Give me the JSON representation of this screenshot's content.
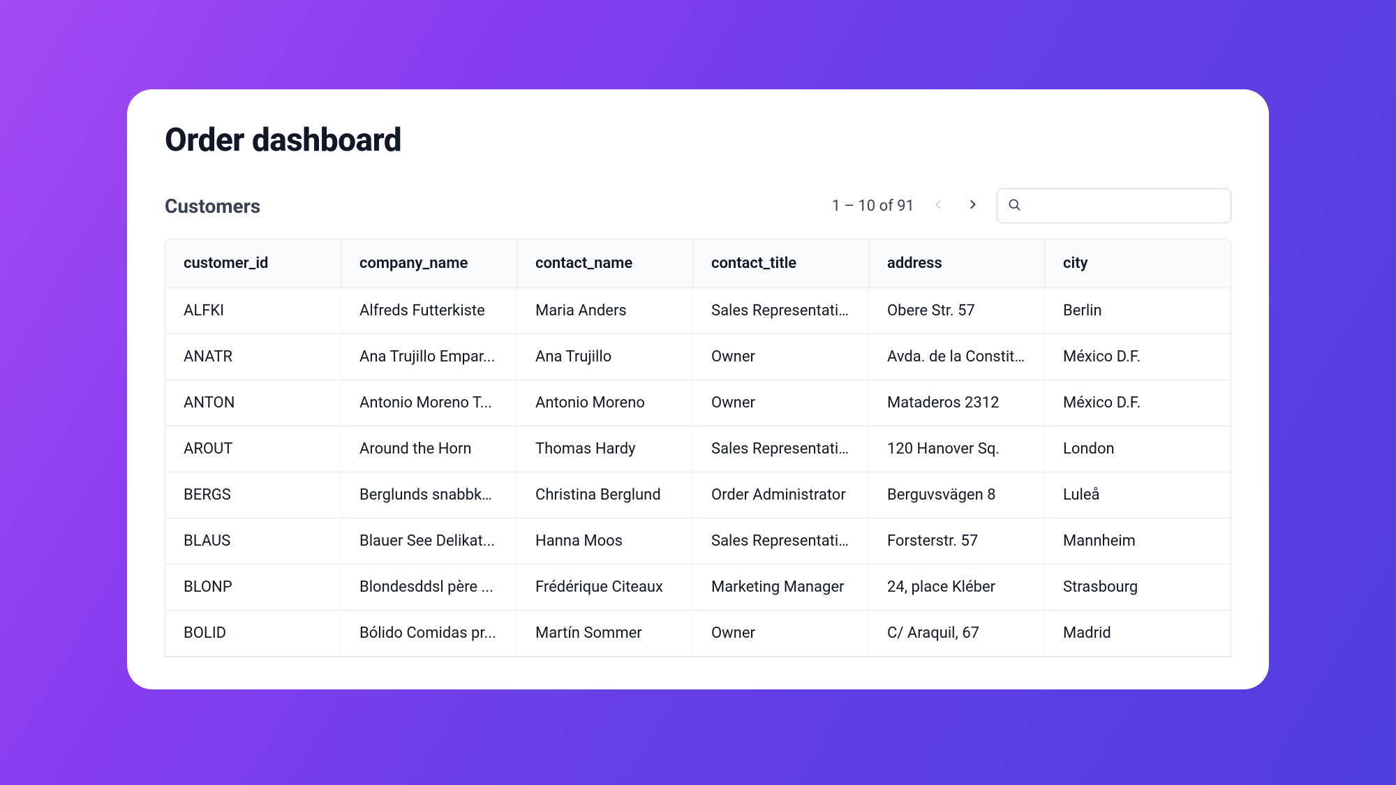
{
  "page": {
    "title": "Order dashboard"
  },
  "section": {
    "title": "Customers"
  },
  "pagination": {
    "range_text": "1 – 10 of 91"
  },
  "search": {
    "value": "",
    "placeholder": ""
  },
  "table": {
    "columns": [
      "customer_id",
      "company_name",
      "contact_name",
      "contact_title",
      "address",
      "city"
    ],
    "rows": [
      {
        "customer_id": "ALFKI",
        "company_name": "Alfreds Futterkiste",
        "contact_name": "Maria Anders",
        "contact_title": "Sales Representati...",
        "address": "Obere Str. 57",
        "city": "Berlin"
      },
      {
        "customer_id": "ANATR",
        "company_name": "Ana Trujillo Empar...",
        "contact_name": "Ana Trujillo",
        "contact_title": "Owner",
        "address": "Avda. de la Constit...",
        "city": "México D.F."
      },
      {
        "customer_id": "ANTON",
        "company_name": "Antonio Moreno T...",
        "contact_name": "Antonio Moreno",
        "contact_title": "Owner",
        "address": "Mataderos 2312",
        "city": "México D.F."
      },
      {
        "customer_id": "AROUT",
        "company_name": "Around the Horn",
        "contact_name": "Thomas Hardy",
        "contact_title": "Sales Representati...",
        "address": "120 Hanover Sq.",
        "city": "London"
      },
      {
        "customer_id": "BERGS",
        "company_name": "Berglunds snabbköp",
        "contact_name": "Christina Berglund",
        "contact_title": "Order Administrator",
        "address": "Berguvsvägen 8",
        "city": "Luleå"
      },
      {
        "customer_id": "BLAUS",
        "company_name": "Blauer See Delikat...",
        "contact_name": "Hanna Moos",
        "contact_title": "Sales Representati...",
        "address": "Forsterstr. 57",
        "city": "Mannheim"
      },
      {
        "customer_id": "BLONP",
        "company_name": "Blondesddsl père ...",
        "contact_name": "Frédérique Citeaux",
        "contact_title": "Marketing Manager",
        "address": "24, place Kléber",
        "city": "Strasbourg"
      },
      {
        "customer_id": "BOLID",
        "company_name": "Bólido Comidas pr...",
        "contact_name": "Martín Sommer",
        "contact_title": "Owner",
        "address": "C/ Araquil, 67",
        "city": "Madrid"
      }
    ]
  }
}
